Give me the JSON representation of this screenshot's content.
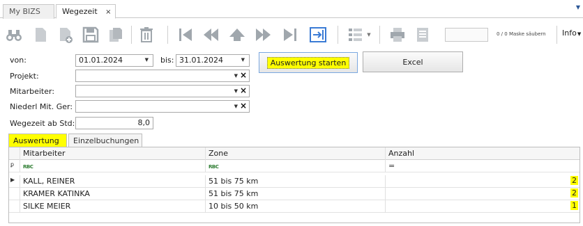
{
  "tabs": [
    {
      "label": "My BIZS"
    },
    {
      "label": "Wegezeit",
      "close": "×"
    }
  ],
  "tab_dropdown_icon": "chevron-down-icon",
  "toolbar": {
    "mask_label": "0 / 0 Maske säubern",
    "info_label": "Info",
    "icons": [
      "binoculars-icon",
      "new-document-icon",
      "add-document-icon",
      "save-icon",
      "copy-icon",
      "delete-icon",
      "first-record-icon",
      "previous-page-icon",
      "up-icon",
      "next-page-icon",
      "last-record-icon",
      "goto-icon",
      "list-view-icon",
      "print-icon",
      "document-icon"
    ]
  },
  "form": {
    "von_label": "von:",
    "von_value": "01.01.2024",
    "bis_label": "bis:",
    "bis_value": "31.01.2024",
    "projekt_label": "Projekt:",
    "projekt_value": "",
    "mitarbeiter_label": "Mitarbeiter:",
    "mitarbeiter_value": "",
    "niederl_label": "Niederl Mit. Ger:",
    "niederl_value": "",
    "wegezeit_label": "Wegezeit ab Std:",
    "wegezeit_value": "8,0",
    "start_button": "Auswertung starten",
    "excel_button": "Excel"
  },
  "subtabs": [
    {
      "label": "Auswertung"
    },
    {
      "label": "Einzelbuchungen"
    }
  ],
  "grid": {
    "columns": [
      "Mitarbeiter",
      "Zone",
      "Anzahl"
    ],
    "filter_text_icon": "RBC",
    "filter_eq": "=",
    "rows": [
      {
        "mitarbeiter": "KALL, REINER",
        "zone": "51 bis 75 km",
        "anzahl": "2"
      },
      {
        "mitarbeiter": "KRAMER KATINKA",
        "zone": "51 bis 75 km",
        "anzahl": "2"
      },
      {
        "mitarbeiter": "SILKE MEIER",
        "zone": "10 bis 50 km",
        "anzahl": "1"
      }
    ]
  },
  "colors": {
    "highlight": "#ffff00",
    "accent": "#2b5797",
    "icon_gray": "#a0a7ad"
  }
}
